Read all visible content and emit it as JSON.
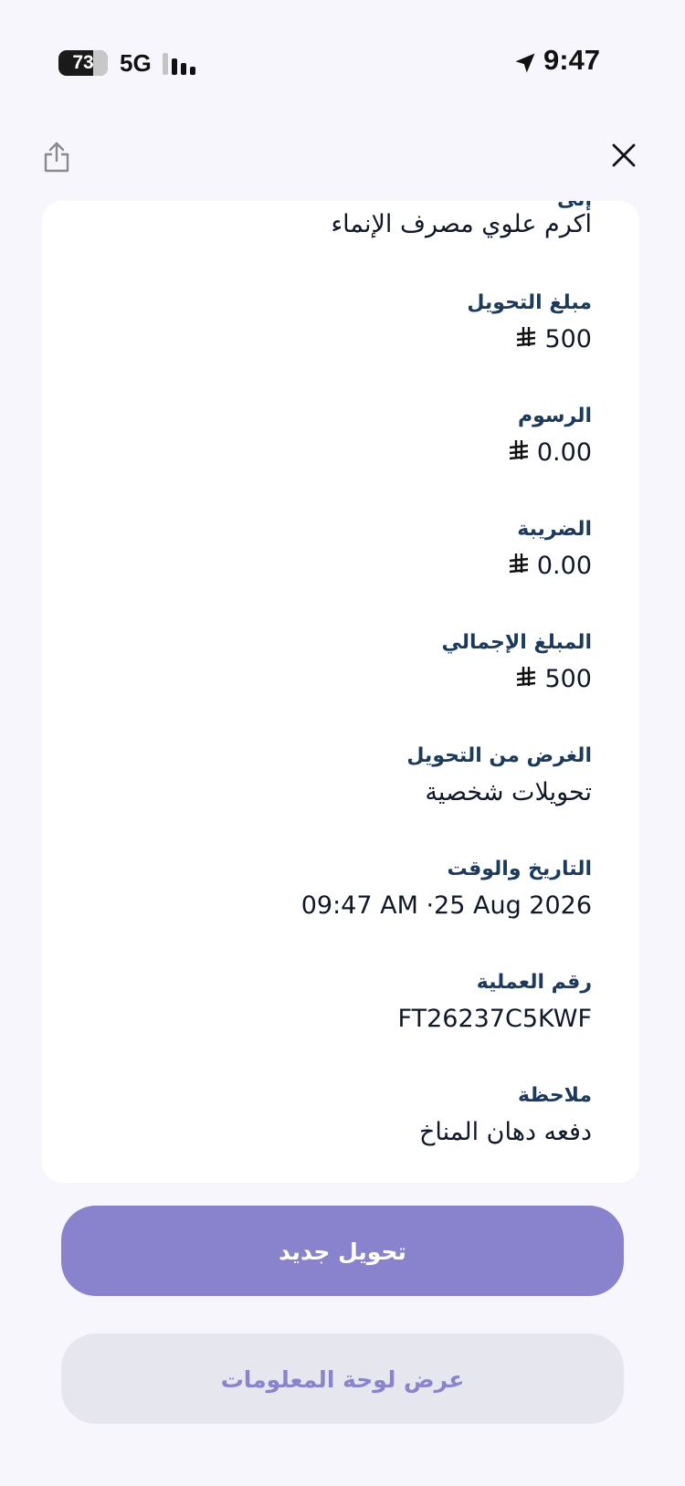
{
  "status_bar": {
    "battery": "73",
    "network": "5G",
    "time": "9:47"
  },
  "header": {
    "share_icon": "share-icon",
    "close_icon": "close-icon"
  },
  "details": {
    "recipient_value": "اكرم علوي مصرف الإنماء",
    "currency_icon": "saudi-riyal-icon",
    "rows": [
      {
        "label": "مبلغ التحويل",
        "value": "500"
      },
      {
        "label": "الرسوم",
        "value": "0.00"
      },
      {
        "label": "الضريبة",
        "value": "0.00"
      },
      {
        "label": "المبلغ الإجمالي",
        "value": "500"
      },
      {
        "label": "الغرض من التحويل",
        "value": "تحويلات شخصية"
      },
      {
        "label": "التاريخ والوقت",
        "value": "09:47 AM ·25 Aug 2026"
      },
      {
        "label": "رقم العملية",
        "value": "FT26237C5KWF"
      },
      {
        "label": "ملاحظة",
        "value": "دفعه دهان المناخ"
      }
    ]
  },
  "actions": {
    "new_transfer": "تحويل جديد",
    "view_dashboard": "عرض لوحة المعلومات"
  },
  "colors": {
    "background": "#f7f6fc",
    "primary_button": "#8883cc",
    "secondary_button": "#e6e6ee",
    "label_color": "#1b3a5c"
  }
}
